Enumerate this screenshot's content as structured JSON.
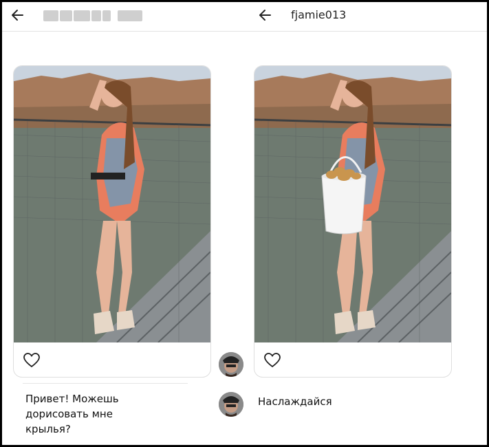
{
  "left_thread": {
    "message": "Привет! Можешь\nдорисовать мне\nкрылья?"
  },
  "right_thread": {
    "username": "fjamie013",
    "reply": "Наслаждайся"
  },
  "icons": {
    "back": "arrow-left-icon",
    "like": "heart-icon"
  },
  "colors": {
    "page_bg": "#ffffff",
    "border": "#dedede",
    "outer_frame": "#000000"
  }
}
